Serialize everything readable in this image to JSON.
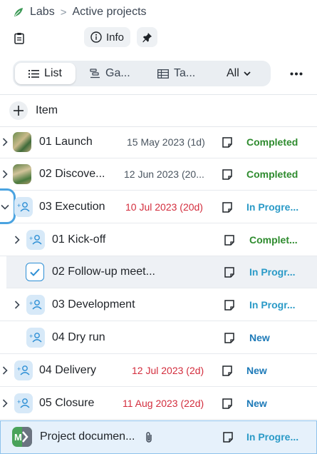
{
  "breadcrumb": {
    "root": "Labs",
    "separator": ">",
    "current": "Active projects"
  },
  "topbar": {
    "info_label": "Info"
  },
  "views": {
    "list": "List",
    "gantt": "Ga...",
    "table": "Ta...",
    "filter": "All"
  },
  "add_item_label": "Item",
  "colors": {
    "completed": "#2e8b2e",
    "in_progress": "#2a9ac7",
    "new": "#1d7ab8",
    "overdue_date": "#d32d3d",
    "date": "#4a5560",
    "accent": "#2d8fd5"
  },
  "rows": [
    {
      "title": "01 Launch",
      "date": "15 May 2023 (1d)",
      "status": "Completed",
      "level": 0,
      "icon": "photo-thumbnail",
      "expandable": true
    },
    {
      "title": "02 Discove...",
      "date": "12 Jun 2023 (20...",
      "status": "Completed",
      "level": 0,
      "icon": "photo-thumbnail",
      "expandable": true
    },
    {
      "title": "03 Execution",
      "date": "10 Jul 2023 (20d)",
      "status": "In Progre...",
      "level": 0,
      "icon": "assign-user-icon",
      "expanded": true
    },
    {
      "title": "01 Kick-off",
      "date": "",
      "status": "Complet...",
      "level": 1,
      "icon": "assign-user-icon",
      "expandable": true
    },
    {
      "title": "02 Follow-up meet...",
      "date": "",
      "status": "In Progr...",
      "level": 1,
      "icon": "checkbox-checked",
      "selected": true
    },
    {
      "title": "03 Development",
      "date": "",
      "status": "In Progr...",
      "level": 1,
      "icon": "assign-user-icon",
      "expandable": true
    },
    {
      "title": "04 Dry run",
      "date": "",
      "status": "New",
      "level": 1,
      "icon": "assign-user-icon"
    },
    {
      "title": "04 Delivery",
      "date": "12 Jul 2023 (2d)",
      "status": "New",
      "level": 0,
      "icon": "assign-user-icon",
      "expandable": true
    },
    {
      "title": "05 Closure",
      "date": "11 Aug 2023 (22d)",
      "status": "New",
      "level": 0,
      "icon": "assign-user-icon",
      "expandable": true
    },
    {
      "title": "Project documen...",
      "date": "",
      "status": "In Progre...",
      "level": 0,
      "icon": "app-logo",
      "attachment": true,
      "highlighted": true
    }
  ]
}
